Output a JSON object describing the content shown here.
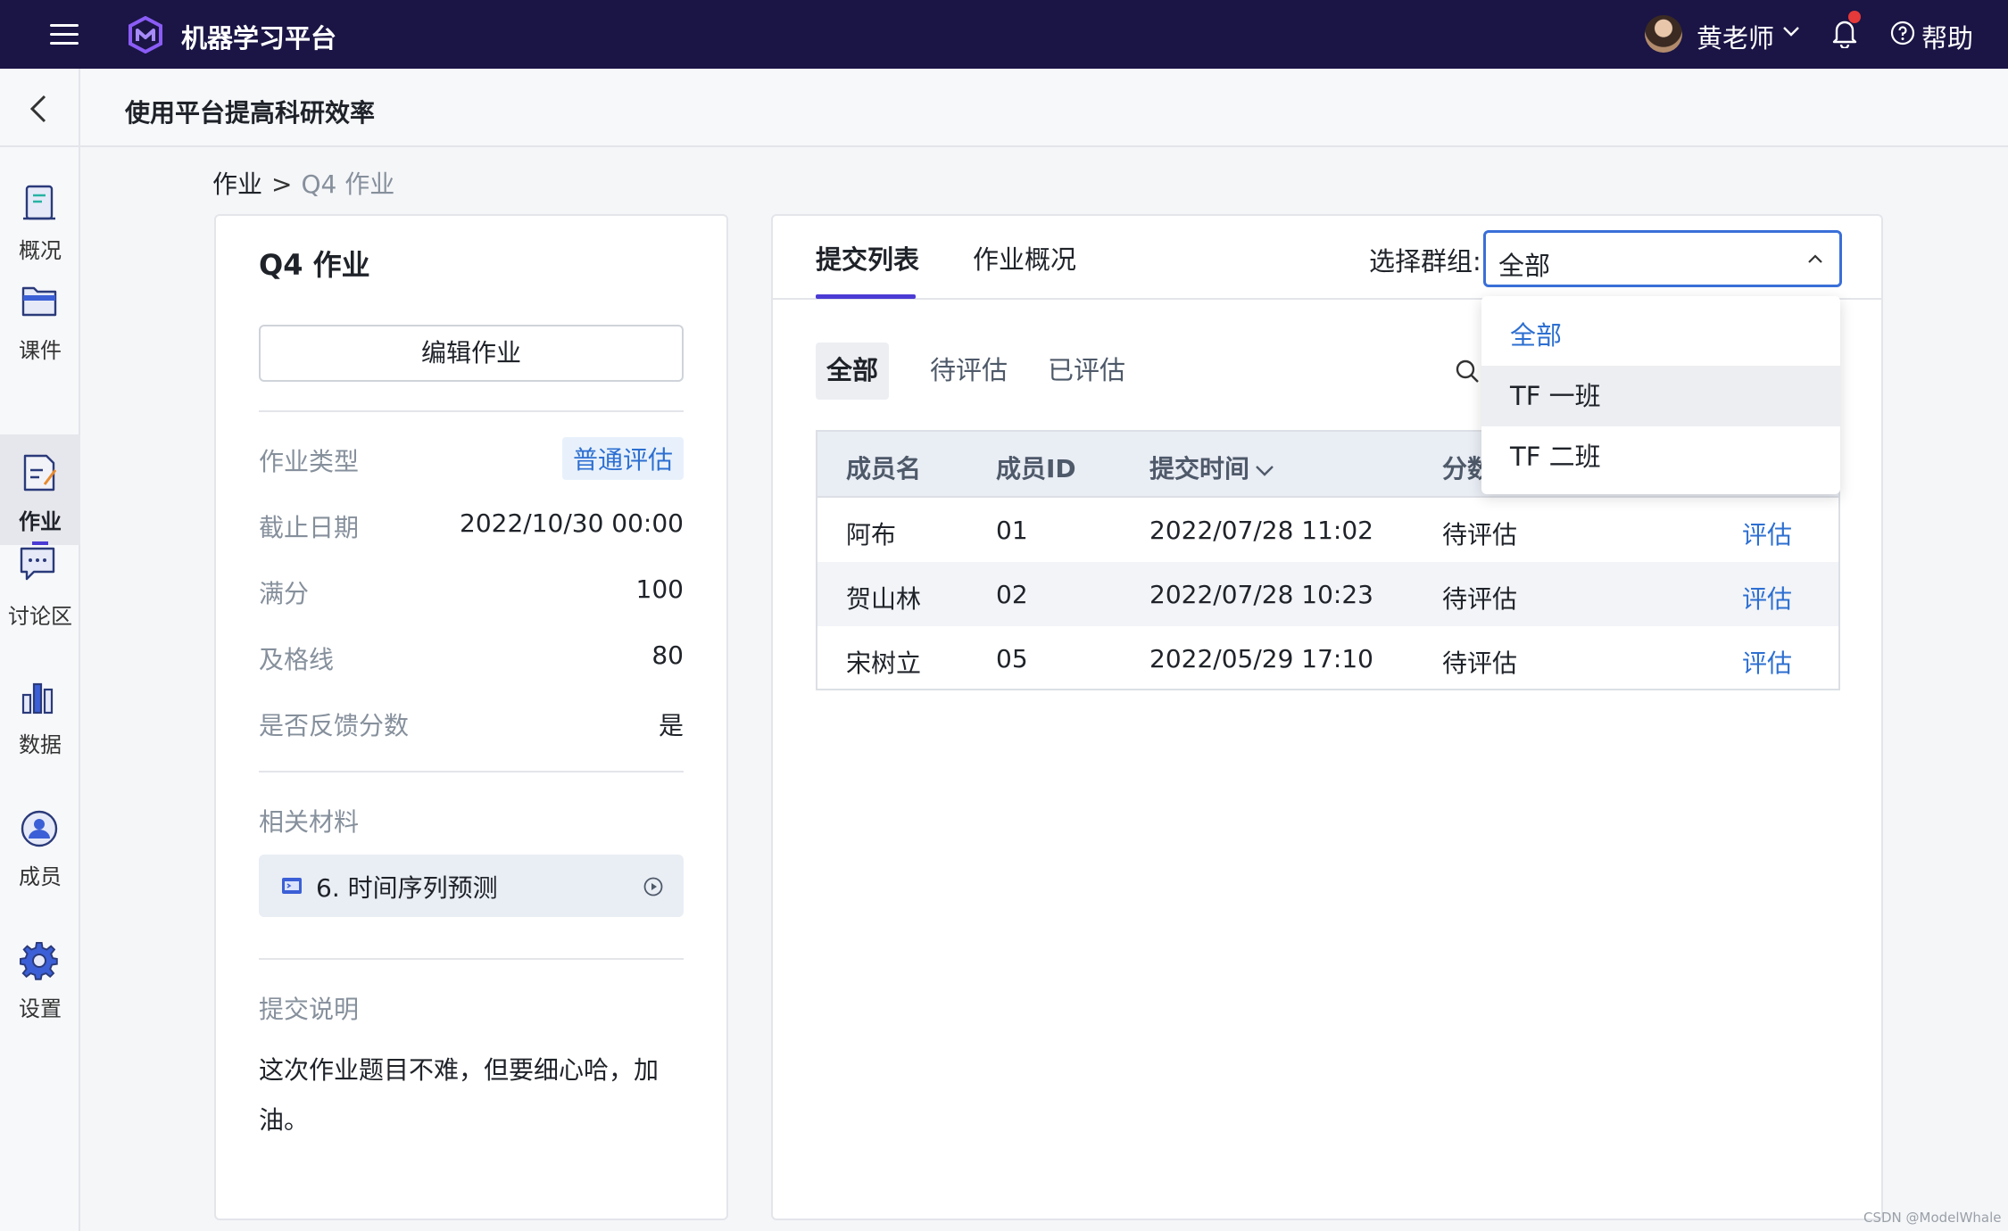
{
  "topbar": {
    "app_title": "机器学习平台",
    "user_name": "黄老师",
    "help_label": "帮助",
    "icons": [
      "menu-icon",
      "logo-icon",
      "chevron-down-icon",
      "bell-icon",
      "help-icon"
    ],
    "colors": {
      "background": "#1a1545",
      "notification_dot": "#e5393a"
    }
  },
  "subheader": {
    "page_title": "使用平台提高科研效率"
  },
  "sidebar": {
    "items": [
      {
        "label": "概况",
        "icon": "overview-icon"
      },
      {
        "label": "课件",
        "icon": "courseware-icon"
      },
      {
        "label": "作业",
        "icon": "assignment-icon",
        "active": true
      },
      {
        "label": "讨论区",
        "icon": "discussion-icon"
      },
      {
        "label": "数据",
        "icon": "data-icon"
      },
      {
        "label": "成员",
        "icon": "members-icon"
      },
      {
        "label": "设置",
        "icon": "settings-icon"
      }
    ]
  },
  "breadcrumb": {
    "root": "作业",
    "separator": ">",
    "current": "Q4 作业"
  },
  "assignment": {
    "title": "Q4 作业",
    "edit_label": "编辑作业",
    "rows": [
      {
        "key": "作业类型",
        "value": "普通评估"
      },
      {
        "key": "截止日期",
        "value": "2022/10/30 00:00"
      },
      {
        "key": "满分",
        "value": "100"
      },
      {
        "key": "及格线",
        "value": "80"
      },
      {
        "key": "是否反馈分数",
        "value": "是"
      }
    ],
    "materials_label": "相关材料",
    "material_name": "6. 时间序列预测",
    "submission_label": "提交说明",
    "submission_text": "这次作业题目不难，但要细心哈，加油。"
  },
  "submissions": {
    "tabs": [
      {
        "label": "提交列表",
        "active": true
      },
      {
        "label": "作业概况"
      }
    ],
    "group_label": "选择群组:",
    "group_value": "全部",
    "filters": [
      {
        "label": "全部",
        "active": true
      },
      {
        "label": "待评估"
      },
      {
        "label": "已评估"
      }
    ],
    "columns": [
      "成员名",
      "成员ID",
      "提交时间",
      "分数"
    ],
    "rows": [
      {
        "name": "阿布",
        "id": "01",
        "time": "2022/07/28 11:02",
        "status": "待评估",
        "action": "评估"
      },
      {
        "name": "贺山林",
        "id": "02",
        "time": "2022/07/28 10:23",
        "status": "待评估",
        "action": "评估"
      },
      {
        "name": "宋树立",
        "id": "05",
        "time": "2022/05/29 17:10",
        "status": "待评估",
        "action": "评估"
      }
    ],
    "dropdown_options": [
      "全部",
      "TF 一班",
      "TF 二班"
    ],
    "accent_color": "#4b3bd4",
    "link_color": "#2d6fd1"
  },
  "watermark": "CSDN @ModelWhale"
}
